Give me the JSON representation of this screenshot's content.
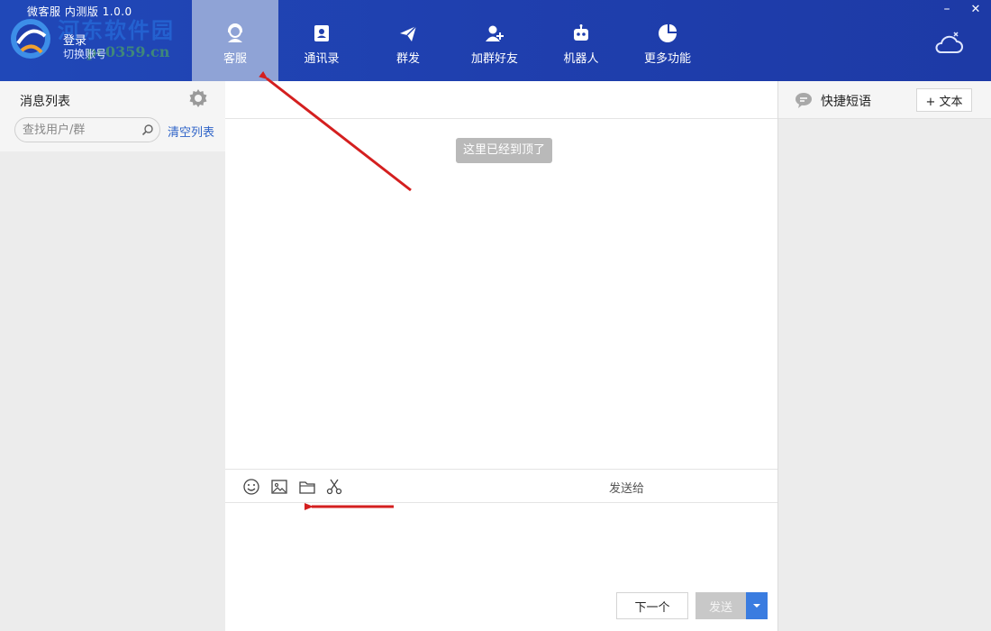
{
  "app": {
    "title": "微客服 内测版 1.0.0",
    "login_label": "登录",
    "switch_account_label": "切换账号",
    "watermark_text": "河东软件园",
    "watermark_url": "pc0359.cn"
  },
  "nav": {
    "tabs": [
      {
        "label": "客服",
        "icon": "customer-service-icon",
        "active": true
      },
      {
        "label": "通讯录",
        "icon": "contacts-icon",
        "active": false
      },
      {
        "label": "群发",
        "icon": "send-plane-icon",
        "active": false
      },
      {
        "label": "加群好友",
        "icon": "add-friend-icon",
        "active": false
      },
      {
        "label": "机器人",
        "icon": "robot-icon",
        "active": false
      },
      {
        "label": "更多功能",
        "icon": "pie-chart-icon",
        "active": false
      }
    ]
  },
  "window": {
    "minimize": "–",
    "close": "✕"
  },
  "sidebar": {
    "title": "消息列表",
    "search_placeholder": "查找用户/群",
    "clear_label": "清空列表"
  },
  "chat": {
    "system_message": "这里已经到顶了",
    "send_to_label": "发送给",
    "next_label": "下一个",
    "send_label": "发送"
  },
  "quick_replies": {
    "title": "快捷短语",
    "add_text_label": "+ 文本"
  },
  "colors": {
    "topbar": "#1f3fae",
    "active_tab": "#8fa3d6",
    "link": "#2f64c8",
    "annotation_arrow": "#d41f1f"
  }
}
